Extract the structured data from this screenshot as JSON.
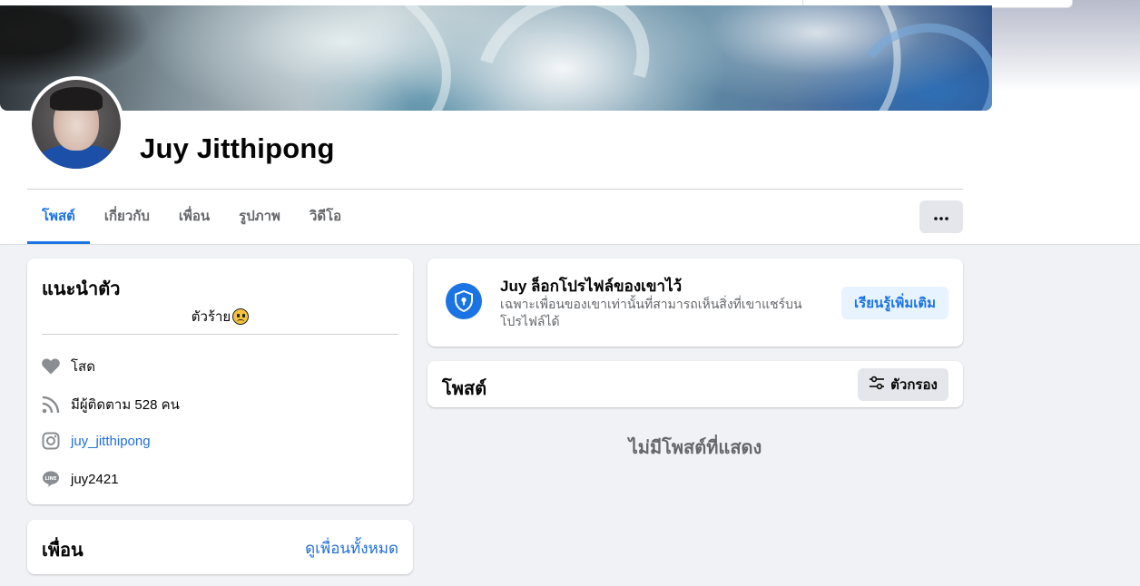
{
  "profile": {
    "name": "Juy Jitthipong"
  },
  "tabs": [
    {
      "label": "โพสต์",
      "active": true
    },
    {
      "label": "เกี่ยวกับ",
      "active": false
    },
    {
      "label": "เพื่อน",
      "active": false
    },
    {
      "label": "รูปภาพ",
      "active": false
    },
    {
      "label": "วิดีโอ",
      "active": false
    }
  ],
  "more_button": {
    "label": "···",
    "icon": "more-dots-icon"
  },
  "intro": {
    "title": "แนะนำตัว",
    "bio": "ตัวร้าย",
    "bio_emoji": "frowning-face-icon",
    "items": [
      {
        "icon": "heart-icon",
        "text": "โสด"
      },
      {
        "icon": "rss-followers-icon",
        "text": "มีผู้ติดตาม 528 คน"
      },
      {
        "icon": "instagram-icon",
        "text": "juy_jitthipong"
      },
      {
        "icon": "line-app-icon",
        "text": "juy2421"
      }
    ]
  },
  "friends": {
    "title": "เพื่อน",
    "see_all": "ดูเพื่อนทั้งหมด"
  },
  "locked_notice": {
    "icon": "shield-lock-icon",
    "title": "Juy ล็อกโปรไฟล์ของเขาไว้",
    "description": "เฉพาะเพื่อนของเขาเท่านั้นที่สามารถเห็นสิ่งที่เขาแชร์บนโปรไฟล์ได้",
    "button": "เรียนรู้เพิ่มเติม"
  },
  "posts": {
    "title": "โพสต์",
    "filter_label": "ตัวกรอง",
    "filter_icon": "filter-sliders-icon",
    "empty_message": "ไม่มีโพสต์ที่แสดง"
  },
  "colors": {
    "accent": "#1b74e4",
    "link": "#216fdb",
    "background": "#f0f2f5",
    "secondary_text": "#65676b"
  }
}
